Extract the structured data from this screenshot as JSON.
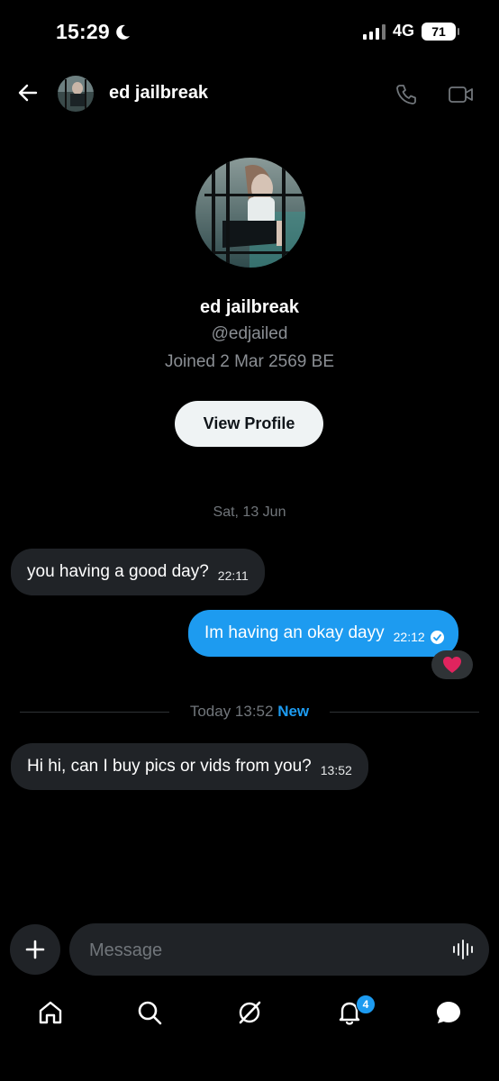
{
  "status_bar": {
    "time": "15:29",
    "network": "4G",
    "battery": "71"
  },
  "header": {
    "name": "ed jailbreak"
  },
  "profile": {
    "name": "ed jailbreak",
    "handle": "@edjailed",
    "joined": "Joined 2 Mar 2569 BE",
    "view_profile_label": "View Profile"
  },
  "conversation": {
    "date_separator": "Sat, 13 Jun",
    "messages": [
      {
        "direction": "incoming",
        "text": "you having a good day?",
        "time": "22:11"
      },
      {
        "direction": "outgoing",
        "text": "Im having an okay dayy",
        "time": "22:12",
        "reaction": "heart"
      },
      {
        "direction": "incoming",
        "text": "Hi hi, can I buy pics or vids from you?",
        "time": "13:52"
      }
    ],
    "today_separator": {
      "label": "Today 13:52",
      "new_label": "New"
    }
  },
  "composer": {
    "placeholder": "Message"
  },
  "bottom_nav": {
    "notifications_badge": "4"
  },
  "colors": {
    "background": "#000000",
    "accent": "#1d9bf0",
    "incoming_bubble": "#202327",
    "muted_text": "#71767b"
  }
}
